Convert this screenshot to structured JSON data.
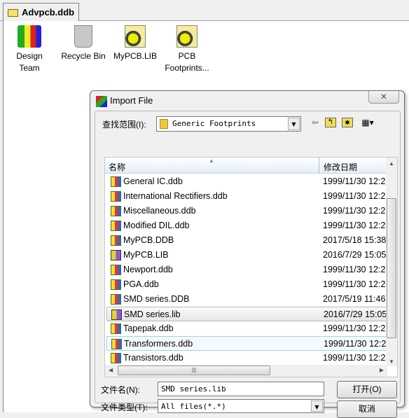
{
  "tab": {
    "label": "Advpcb.ddb",
    "icon": "folder-icon"
  },
  "desktop": [
    {
      "label": "Design Team",
      "icon": "design-team-icon"
    },
    {
      "label": "Recycle Bin",
      "icon": "recycle-bin-icon"
    },
    {
      "label": "MyPCB.LIB",
      "icon": "library-icon"
    },
    {
      "label": "PCB Footprints...",
      "icon": "library-icon"
    }
  ],
  "dialog": {
    "title": "Import File",
    "close": "✕",
    "look_in_label": "查找范围(I):",
    "look_in_value": "Generic Footprints",
    "columns": [
      "名称",
      "修改日期"
    ],
    "files": [
      {
        "name": "General IC.ddb",
        "date": "1999/11/30 12:2",
        "type": "ddb"
      },
      {
        "name": "International Rectifiers.ddb",
        "date": "1999/11/30 12:2",
        "type": "ddb"
      },
      {
        "name": "Miscellaneous.ddb",
        "date": "1999/11/30 12:2",
        "type": "ddb"
      },
      {
        "name": "Modified DIL.ddb",
        "date": "1999/11/30 12:2",
        "type": "ddb"
      },
      {
        "name": "MyPCB.DDB",
        "date": "2017/5/18 15:38",
        "type": "ddb"
      },
      {
        "name": "MyPCB.LIB",
        "date": "2016/7/29 15:05",
        "type": "lib"
      },
      {
        "name": "Newport.ddb",
        "date": "1999/11/30 12:2",
        "type": "ddb"
      },
      {
        "name": "PGA.ddb",
        "date": "1999/11/30 12:2",
        "type": "ddb"
      },
      {
        "name": "SMD series.DDB",
        "date": "2017/5/19 11:46",
        "type": "ddb"
      },
      {
        "name": "SMD series.lib",
        "date": "2016/7/29 15:05",
        "type": "lib"
      },
      {
        "name": "Tapepak.ddb",
        "date": "1999/11/30 12:2",
        "type": "ddb"
      },
      {
        "name": "Transformers.ddb",
        "date": "1999/11/30 12:2",
        "type": "ddb"
      },
      {
        "name": "Transistors.ddb",
        "date": "1999/11/30 12:2",
        "type": "ddb"
      }
    ],
    "selected": "SMD series.lib",
    "hovered": "Transformers.ddb",
    "filename_label": "文件名(N):",
    "filename_value": "SMD series.lib",
    "filetype_label": "文件类型(T):",
    "filetype_value": "All files(*.*)",
    "open_button": "打开(O)",
    "cancel_button": "取消"
  }
}
